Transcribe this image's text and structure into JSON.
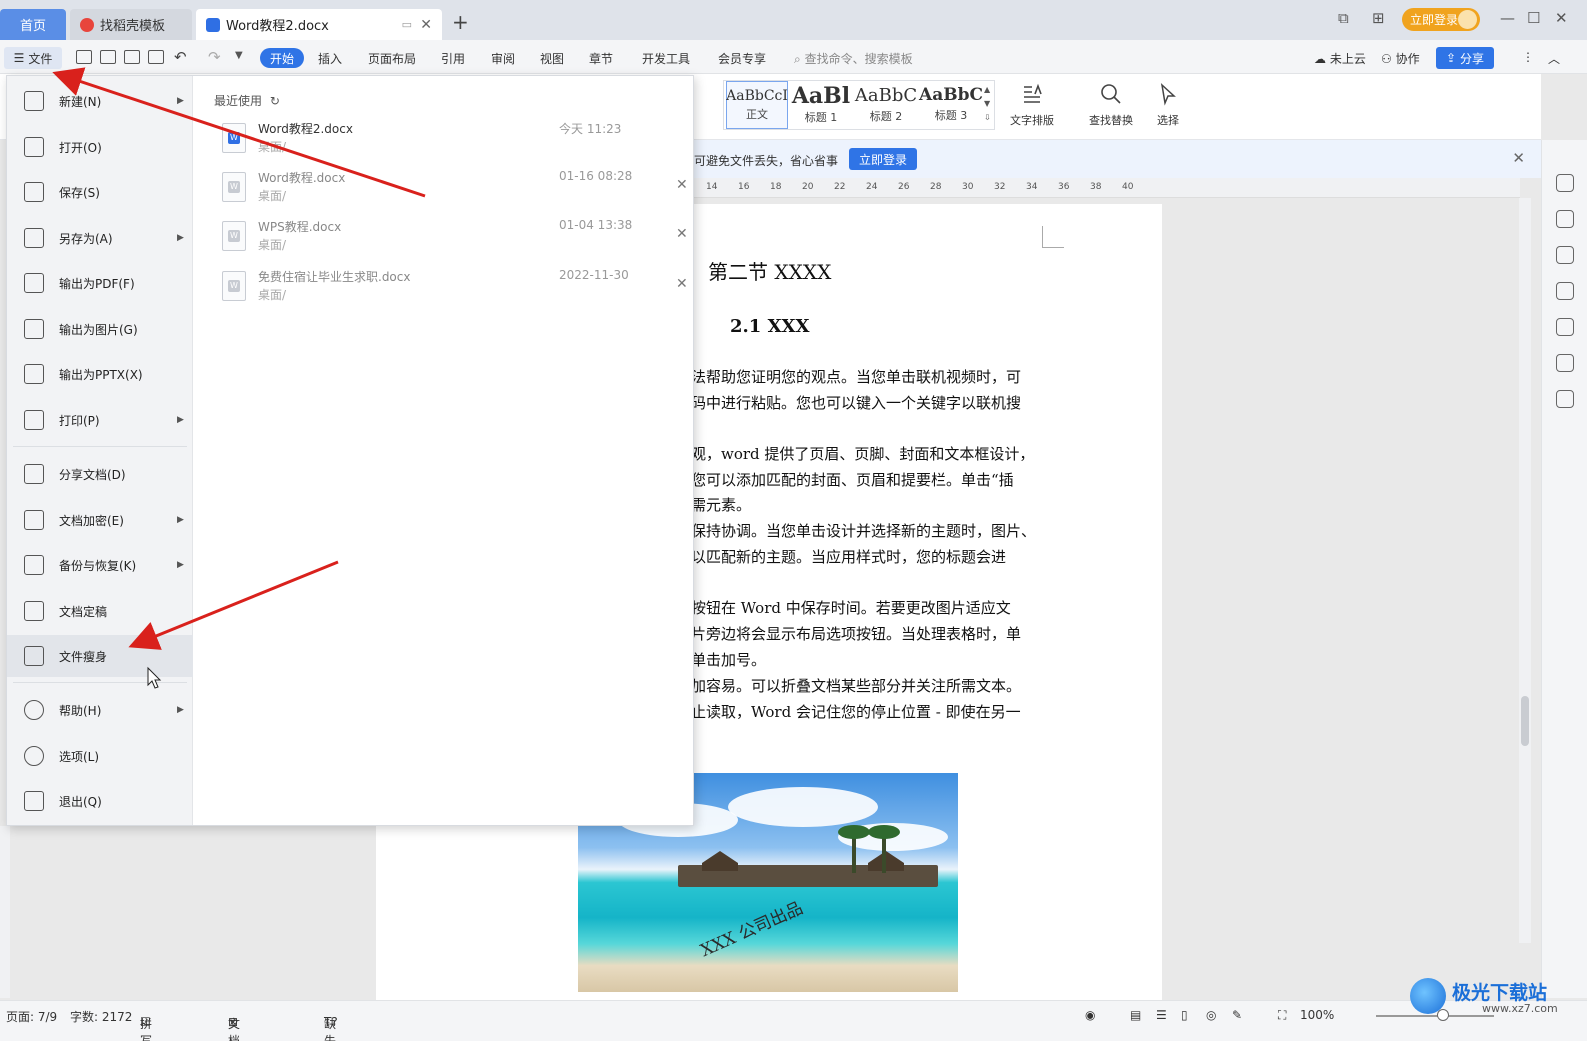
{
  "tabs": {
    "home": "首页",
    "template": "找稻壳模板",
    "doc": "Word教程2.docx"
  },
  "login_button": "立即登录",
  "menubar": {
    "file": "文件",
    "tabs": [
      "开始",
      "插入",
      "页面布局",
      "引用",
      "审阅",
      "视图",
      "章节",
      "开发工具",
      "会员专享"
    ],
    "search": "查找命令、搜索模板",
    "cloud": "未上云",
    "collab": "协作",
    "share": "分享"
  },
  "styles": [
    {
      "sample": "AaBbCcI",
      "label": "正文"
    },
    {
      "sample": "AaBl",
      "label": "标题 1"
    },
    {
      "sample": "AaBbC",
      "label": "标题 2"
    },
    {
      "sample": "AaBbC",
      "label": "标题 3"
    }
  ],
  "tools": {
    "text_layout": "文字排版",
    "find_replace": "查找替换",
    "select": "选择"
  },
  "notice": {
    "text": "可避免文件丢失，省心省事",
    "button": "立即登录"
  },
  "ruler_ticks": [
    "14",
    "16",
    "18",
    "20",
    "22",
    "24",
    "26",
    "28",
    "30",
    "32",
    "34",
    "36",
    "38",
    "40"
  ],
  "document": {
    "heading2": "第二节  XXXX",
    "heading3": "2.1 XXX",
    "lines": [
      "方法帮助您证明您的观点。当您单击联机视频时，可",
      "代码中进行粘贴。您也可以键入一个关键字以联机搜",
      "",
      "外观，word 提供了页眉、页脚、封面和文本框设计，",
      "。您可以添加匹配的封面、页眉和提要栏。单击“插",
      "所需元素。",
      "当保持协调。当您单击设计并选择新的主题时，图片、",
      "改以匹配新的主题。当应用样式时，您的标题会进",
      "",
      "新按钮在 Word 中保存时间。若要更改图片适应文",
      "图片旁边将会显示布局选项按钮。当处理表格时，单",
      "后单击加号。",
      "更加容易。可以折叠文档某些部分并关注所需文本。",
      "停止读取，Word 会记住您的停止位置 - 即使在另一"
    ],
    "watermark": "XXX 公司出品"
  },
  "file_menu": {
    "items": [
      {
        "label": "新建(N)",
        "arrow": true
      },
      {
        "label": "打开(O)",
        "arrow": false
      },
      {
        "label": "保存(S)",
        "arrow": false
      },
      {
        "label": "另存为(A)",
        "arrow": true
      },
      {
        "label": "输出为PDF(F)",
        "arrow": false
      },
      {
        "label": "输出为图片(G)",
        "arrow": false
      },
      {
        "label": "输出为PPTX(X)",
        "arrow": false
      },
      {
        "label": "打印(P)",
        "arrow": true
      },
      {
        "label": "分享文档(D)",
        "arrow": false
      },
      {
        "label": "文档加密(E)",
        "arrow": true
      },
      {
        "label": "备份与恢复(K)",
        "arrow": true
      },
      {
        "label": "文档定稿",
        "arrow": false
      },
      {
        "label": "文件瘦身",
        "arrow": false
      },
      {
        "label": "帮助(H)",
        "arrow": true
      },
      {
        "label": "选项(L)",
        "arrow": false
      },
      {
        "label": "退出(Q)",
        "arrow": false
      }
    ],
    "arrow_glyph": "▶",
    "recent_title": "最近使用",
    "recent": [
      {
        "name": "Word教程2.docx",
        "path": "桌面/",
        "time": "今天  11:23"
      },
      {
        "name": "Word教程.docx",
        "path": "桌面/",
        "time": "01-16 08:28"
      },
      {
        "name": "WPS教程.docx",
        "path": "桌面/",
        "time": "01-04 13:38"
      },
      {
        "name": "免费住宿让毕业生求职.docx",
        "path": "桌面/",
        "time": "2022-11-30"
      }
    ]
  },
  "status": {
    "page": "页面: 7/9",
    "words": "字数: 2172",
    "spell": "拼写检查",
    "proof": "文档校对",
    "font": "缺失字体",
    "zoom": "100%"
  },
  "site_logo": {
    "name": "极光下载站",
    "url": "www.xz7.com"
  },
  "colors": {
    "accent": "#2f74e6",
    "annotation_arrow": "#d9211c",
    "login_pill": "#f0a31e"
  }
}
